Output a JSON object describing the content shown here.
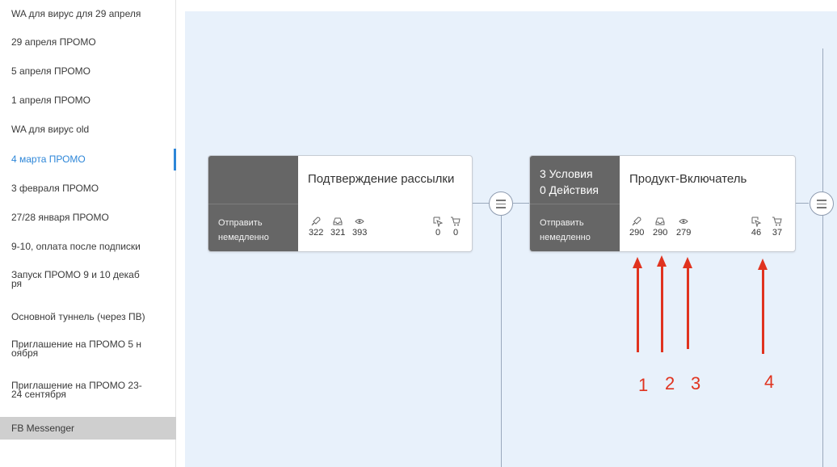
{
  "sidebar": {
    "items": [
      {
        "label": "WA для вирус для 29 апреля"
      },
      {
        "label": "29 апреля ПРОМО"
      },
      {
        "label": "5 апреля ПРОМО"
      },
      {
        "label": "1 апреля ПРОМО"
      },
      {
        "label": "WA для вирус old"
      },
      {
        "label": "4 марта ПРОМО"
      },
      {
        "label": "3 февраля ПРОМО"
      },
      {
        "label": "27/28 января ПРОМО"
      },
      {
        "label": "9-10, оплата после подписки"
      },
      {
        "label": "Запуск ПРОМО 9 и 10 декаб\nря"
      },
      {
        "label": "Основной туннель (через ПВ)"
      },
      {
        "label": "Приглашение на ПРОМО 5 н\nоября"
      },
      {
        "label": "Приглашение на ПРОМО 23-\n24 сентября"
      },
      {
        "label": "FB Messenger"
      }
    ],
    "active_index": 5,
    "selected_index": 13,
    "accent_color": "#2d86d8"
  },
  "nodes": [
    {
      "title": "Подтверждение рассылки",
      "conditions": "",
      "actions": "",
      "send_line1": "Отправить",
      "send_line2": "немедленно",
      "stats": {
        "sent": "322",
        "delivered": "321",
        "opened": "393",
        "clicked": "0",
        "purchased": "0"
      }
    },
    {
      "title": "Продукт-Включатель",
      "conditions": "3 Условия",
      "actions": "0 Действия",
      "send_line1": "Отправить",
      "send_line2": "немедленно",
      "stats": {
        "sent": "290",
        "delivered": "290",
        "opened": "279",
        "clicked": "46",
        "purchased": "37"
      }
    }
  ],
  "icons": {
    "sent": "rocket-icon",
    "delivered": "inbox-icon",
    "opened": "eye-icon",
    "clicked": "cursor-icon",
    "purchased": "cart-icon",
    "menu": "menu-lines-icon"
  },
  "annotations": [
    "1",
    "2",
    "3",
    "4"
  ],
  "colors": {
    "canvas": "#e8f1fb",
    "node_dark": "#666666",
    "annotation": "#e0331f"
  }
}
